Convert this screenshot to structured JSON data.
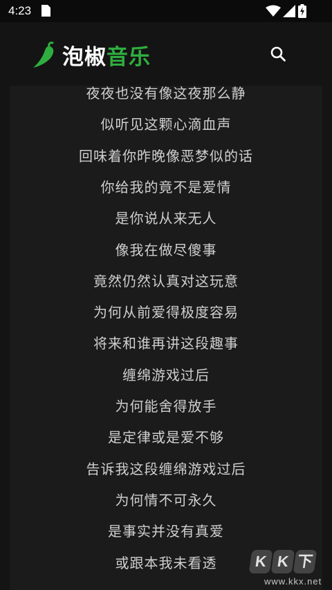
{
  "status_bar": {
    "time": "4:23"
  },
  "header": {
    "logo_part1": "泡椒",
    "logo_part2": "音乐",
    "accent_color": "#2fae3f",
    "search_icon": "search-icon"
  },
  "lyrics": [
    "夜夜也没有像这夜那么静",
    "似听见这颗心滴血声",
    "回味着你昨晚像恶梦似的话",
    "你给我的竟不是爱情",
    "是你说从来无人",
    "像我在做尽傻事",
    "竟然仍然认真对这玩意",
    "为何从前爱得极度容易",
    "将来和谁再讲这段趣事",
    "缠绵游戏过后",
    "为何能舍得放手",
    "是定律或是爱不够",
    "告诉我这段缠绵游戏过后",
    "为何情不可永久",
    "是事实并没有真爱",
    "或跟本我未看透"
  ],
  "watermark": {
    "letters": [
      "K",
      "K",
      "下"
    ],
    "url": "www.kkx.net"
  }
}
